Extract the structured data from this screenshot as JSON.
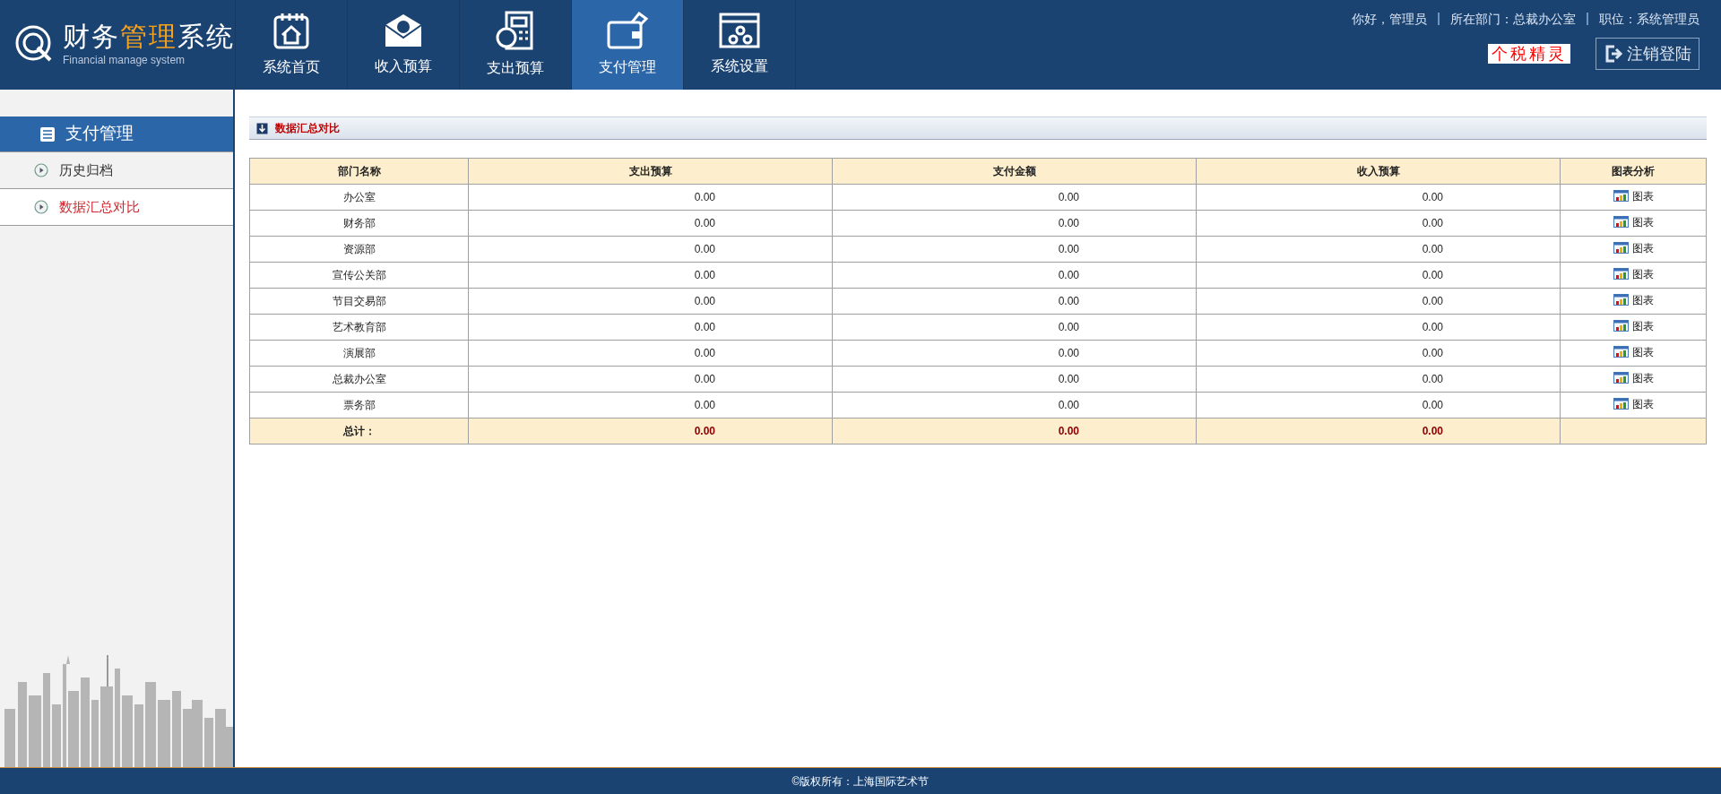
{
  "logo": {
    "title_parts": [
      {
        "text": "财务",
        "highlight": false
      },
      {
        "text": "管理",
        "highlight": true
      },
      {
        "text": "系统",
        "highlight": false
      }
    ],
    "subtitle": "Financial manage system"
  },
  "nav": [
    {
      "label": "系统首页",
      "selected": false
    },
    {
      "label": "收入预算",
      "selected": false
    },
    {
      "label": "支出预算",
      "selected": false
    },
    {
      "label": "支付管理",
      "selected": true
    },
    {
      "label": "系统设置",
      "selected": false
    }
  ],
  "user_info": [
    "你好，管理员",
    "所在部门：总裁办公室",
    "职位：系统管理员"
  ],
  "tax_link": "个税精灵",
  "logout": "注销登陆",
  "sidebar": {
    "title": "支付管理",
    "items": [
      {
        "label": "历史归档",
        "selected": false
      },
      {
        "label": "数据汇总对比",
        "selected": true
      }
    ]
  },
  "panel": {
    "title": "数据汇总对比"
  },
  "table": {
    "columns": [
      "部门名称",
      "支出预算",
      "支付金额",
      "收入预算",
      "图表分析"
    ],
    "rows": [
      [
        "办公室",
        "0.00",
        "0.00",
        "0.00",
        "图表"
      ],
      [
        "财务部",
        "0.00",
        "0.00",
        "0.00",
        "图表"
      ],
      [
        "资源部",
        "0.00",
        "0.00",
        "0.00",
        "图表"
      ],
      [
        "宣传公关部",
        "0.00",
        "0.00",
        "0.00",
        "图表"
      ],
      [
        "节目交易部",
        "0.00",
        "0.00",
        "0.00",
        "图表"
      ],
      [
        "艺术教育部",
        "0.00",
        "0.00",
        "0.00",
        "图表"
      ],
      [
        "演展部",
        "0.00",
        "0.00",
        "0.00",
        "图表"
      ],
      [
        "总裁办公室",
        "0.00",
        "0.00",
        "0.00",
        "图表"
      ],
      [
        "票务部",
        "0.00",
        "0.00",
        "0.00",
        "图表"
      ]
    ],
    "total": [
      "总计：",
      "0.00",
      "0.00",
      "0.00"
    ]
  },
  "footer": "©版权所有：上海国际艺术节"
}
